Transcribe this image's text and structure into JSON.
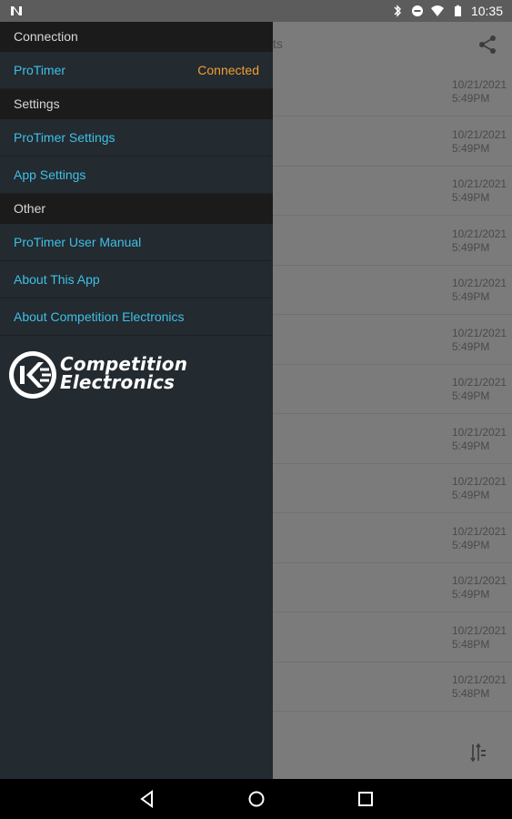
{
  "status_bar": {
    "time": "10:35",
    "icons": [
      "n-icon",
      "bluetooth-icon",
      "do-not-disturb-icon",
      "wifi-icon",
      "battery-icon"
    ]
  },
  "background": {
    "title_fragment": "ts",
    "rows": [
      {
        "date": "10/21/2021",
        "time": "5:49PM"
      },
      {
        "date": "10/21/2021",
        "time": "5:49PM"
      },
      {
        "date": "10/21/2021",
        "time": "5:49PM"
      },
      {
        "date": "10/21/2021",
        "time": "5:49PM"
      },
      {
        "date": "10/21/2021",
        "time": "5:49PM"
      },
      {
        "date": "10/21/2021",
        "time": "5:49PM"
      },
      {
        "date": "10/21/2021",
        "time": "5:49PM"
      },
      {
        "date": "10/21/2021",
        "time": "5:49PM"
      },
      {
        "date": "10/21/2021",
        "time": "5:49PM"
      },
      {
        "date": "10/21/2021",
        "time": "5:49PM"
      },
      {
        "date": "10/21/2021",
        "time": "5:49PM"
      },
      {
        "date": "10/21/2021",
        "time": "5:48PM"
      },
      {
        "date": "10/21/2021",
        "time": "5:48PM"
      }
    ]
  },
  "drawer": {
    "sections": [
      {
        "header": "Connection",
        "items": [
          {
            "label": "ProTimer",
            "badge": "Connected"
          }
        ]
      },
      {
        "header": "Settings",
        "items": [
          {
            "label": "ProTimer Settings"
          },
          {
            "label": "App Settings"
          }
        ]
      },
      {
        "header": "Other",
        "items": [
          {
            "label": "ProTimer User Manual"
          },
          {
            "label": "About This App"
          },
          {
            "label": "About Competition Electronics"
          }
        ]
      }
    ],
    "logo": {
      "line1": "Competition",
      "line2": "Electronics"
    }
  },
  "colors": {
    "link": "#3fc0e6",
    "connected": "#f0a030",
    "drawer_bg": "#232a30",
    "section_bg": "#1b1b1b"
  }
}
